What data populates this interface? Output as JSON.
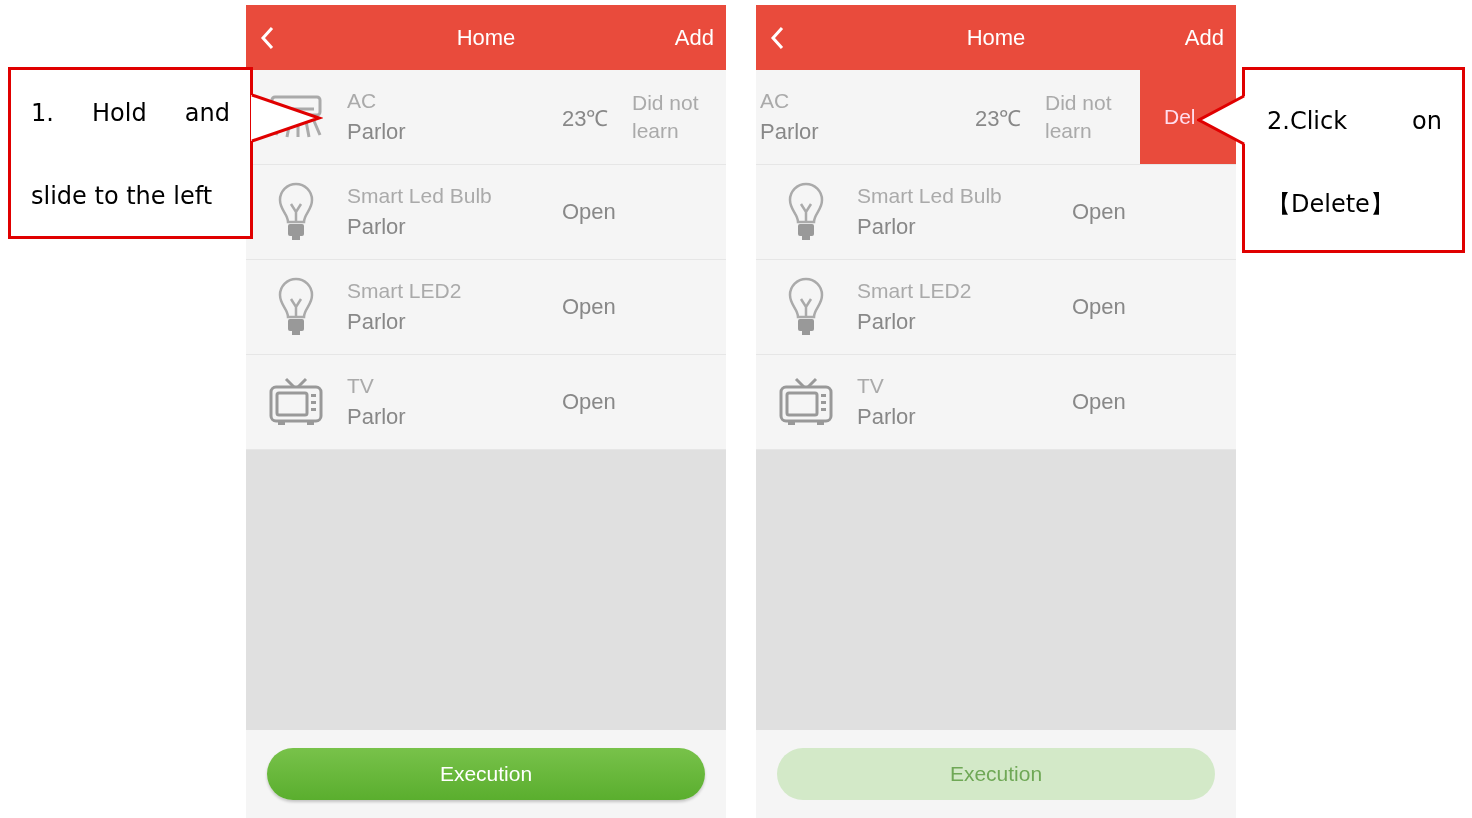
{
  "callouts": [
    {
      "text": "1.  Hold  and slide to the left",
      "kind": "left"
    },
    {
      "text": "2.Click on 【Delete】",
      "kind": "right"
    }
  ],
  "screens": [
    {
      "header": {
        "title": "Home",
        "action": "Add"
      },
      "devices": [
        {
          "kind": "ac",
          "name": "AC",
          "room": "Parlor",
          "status": "23℃",
          "note": "Did not learn"
        },
        {
          "kind": "bulb",
          "name": "Smart Led Bulb",
          "room": "Parlor",
          "status": "Open"
        },
        {
          "kind": "bulb",
          "name": "Smart LED2",
          "room": "Parlor",
          "status": "Open"
        },
        {
          "kind": "tv",
          "name": "TV",
          "room": "Parlor",
          "status": "Open"
        }
      ],
      "execution": {
        "label": "Execution",
        "disabled": false
      }
    },
    {
      "header": {
        "title": "Home",
        "action": "Add"
      },
      "devices": [
        {
          "name": "AC",
          "room": "Parlor",
          "status": "23℃",
          "note": "Did not learn",
          "swiped": true,
          "delete_label": "Del"
        },
        {
          "kind": "bulb",
          "name": "Smart Led Bulb",
          "room": "Parlor",
          "status": "Open"
        },
        {
          "kind": "bulb",
          "name": "Smart LED2",
          "room": "Parlor",
          "status": "Open"
        },
        {
          "kind": "tv",
          "name": "TV",
          "room": "Parlor",
          "status": "Open"
        }
      ],
      "execution": {
        "label": "Execution",
        "disabled": true
      }
    }
  ]
}
